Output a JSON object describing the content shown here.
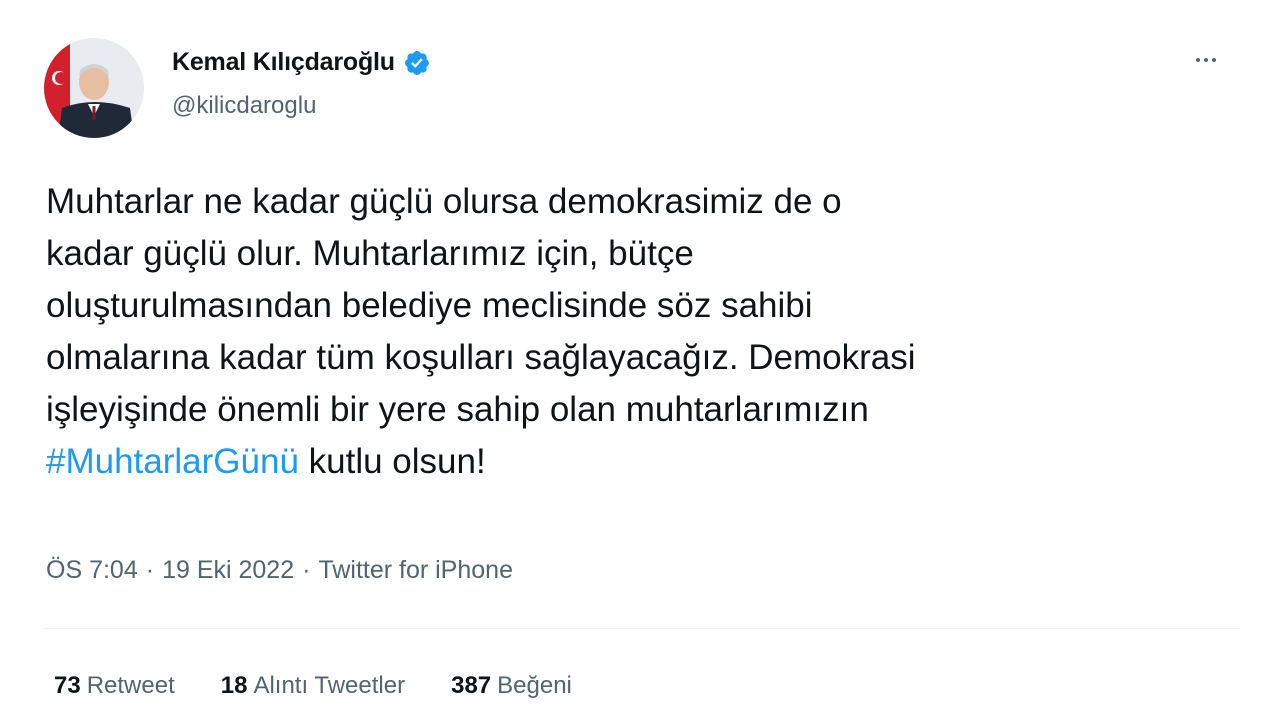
{
  "author": {
    "display_name": "Kemal Kılıçdaroğlu",
    "handle": "@kilicdaroglu",
    "verified_icon": "verified-badge-icon"
  },
  "tweet": {
    "lines": [
      "Muhtarlar ne kadar güçlü olursa demokrasimiz de o",
      "kadar güçlü olur. Muhtarlarımız için, bütçe",
      "oluşturulmasından belediye meclisinde söz sahibi",
      "olmalarına kadar tüm koşulları sağlayacağız. Demokrasi",
      "işleyişinde önemli bir yere sahip olan muhtarlarımızın"
    ],
    "hashtag": "#MuhtarlarGünü",
    "last_line_rest": " kutlu olsun!"
  },
  "meta": {
    "time": "ÖS 7:04",
    "separator": "·",
    "date": "19 Eki 2022",
    "source": "Twitter for iPhone"
  },
  "stats": {
    "retweets_count": "73",
    "retweets_label": "Retweet",
    "quotes_count": "18",
    "quotes_label": "Alıntı Tweetler",
    "likes_count": "387",
    "likes_label": "Beğeni"
  },
  "colors": {
    "link": "#1d9bf0",
    "text": "#0f1419",
    "secondary": "#536471",
    "verified": "#1d9bf0"
  }
}
